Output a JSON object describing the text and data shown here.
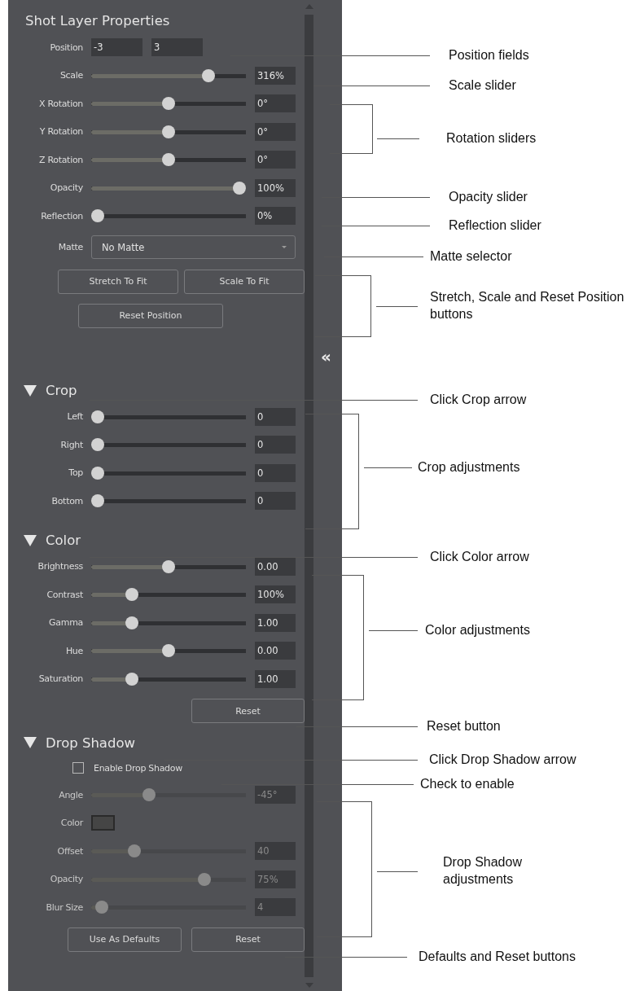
{
  "panel": {
    "title": "Shot Layer Properties",
    "collapse_glyph": "«",
    "rows": [
      {
        "kind": "position",
        "label": "Position",
        "values": [
          "-3",
          "3"
        ]
      },
      {
        "kind": "slider",
        "label": "Scale",
        "level": 0.78,
        "value": "316%",
        "disabled": false
      },
      {
        "kind": "slider",
        "label": "X Rotation",
        "level": 0.5,
        "value": "0°",
        "disabled": false
      },
      {
        "kind": "slider",
        "label": "Y Rotation",
        "level": 0.5,
        "value": "0°",
        "disabled": false
      },
      {
        "kind": "slider",
        "label": "Z Rotation",
        "level": 0.5,
        "value": "0°",
        "disabled": false
      },
      {
        "kind": "slider",
        "label": "Opacity",
        "level": 1,
        "value": "100%",
        "disabled": false
      },
      {
        "kind": "slider",
        "label": "Reflection",
        "level": 0,
        "value": "0%",
        "disabled": false
      },
      {
        "kind": "select",
        "label": "Matte",
        "value": "No Matte"
      },
      {
        "kind": "buttons",
        "buttons": [
          "Stretch To Fit",
          "Scale To Fit"
        ]
      },
      {
        "kind": "buttons",
        "buttons": [
          "Reset Position"
        ]
      }
    ],
    "sections": [
      {
        "title": "Crop",
        "expanded": true,
        "rows": [
          {
            "kind": "slider",
            "label": "Left",
            "level": 0,
            "value": "0",
            "disabled": false
          },
          {
            "kind": "slider",
            "label": "Right",
            "level": 0,
            "value": "0",
            "disabled": false
          },
          {
            "kind": "slider",
            "label": "Top",
            "level": 0,
            "value": "0",
            "disabled": false
          },
          {
            "kind": "slider",
            "label": "Bottom",
            "level": 0,
            "value": "0",
            "disabled": false
          }
        ]
      },
      {
        "title": "Color",
        "expanded": true,
        "rows": [
          {
            "kind": "slider",
            "label": "Brightness",
            "level": 0.5,
            "value": "0.00",
            "disabled": false
          },
          {
            "kind": "slider",
            "label": "Contrast",
            "level": 0.24,
            "value": "100%",
            "disabled": false
          },
          {
            "kind": "slider",
            "label": "Gamma",
            "level": 0.24,
            "value": "1.00",
            "disabled": false
          },
          {
            "kind": "slider",
            "label": "Hue",
            "level": 0.5,
            "value": "0.00",
            "disabled": false
          },
          {
            "kind": "slider",
            "label": "Saturation",
            "level": 0.24,
            "value": "1.00",
            "disabled": false
          },
          {
            "kind": "buttons",
            "buttons": [
              "Reset"
            ]
          }
        ]
      },
      {
        "title": "Drop Shadow",
        "expanded": true,
        "rows": [
          {
            "kind": "checkbox",
            "label": "Enable Drop Shadow",
            "checked": false
          },
          {
            "kind": "slider",
            "label": "Angle",
            "level": 0.36,
            "value": "-45°",
            "disabled": true
          },
          {
            "kind": "swatch",
            "label": "Color",
            "color": "#454545",
            "disabled": true
          },
          {
            "kind": "slider",
            "label": "Offset",
            "level": 0.26,
            "value": "40",
            "disabled": true
          },
          {
            "kind": "slider",
            "label": "Opacity",
            "level": 0.75,
            "value": "75%",
            "disabled": true
          },
          {
            "kind": "slider",
            "label": "Blur Size",
            "level": 0.03,
            "value": "4",
            "disabled": true
          },
          {
            "kind": "buttons",
            "buttons": [
              "Use As Defaults",
              "Reset"
            ]
          }
        ]
      }
    ]
  },
  "callouts": [
    {
      "kind": "line",
      "text": "Position fields"
    },
    {
      "kind": "line",
      "text": "Scale slider"
    },
    {
      "kind": "bracket",
      "text": "Rotation sliders"
    },
    {
      "kind": "line",
      "text": "Opacity slider"
    },
    {
      "kind": "line",
      "text": "Reflection slider"
    },
    {
      "kind": "line",
      "text": "Matte selector"
    },
    {
      "kind": "bracket",
      "text": "Stretch, Scale and Reset Position buttons"
    },
    {
      "kind": "line",
      "text": "Click Crop arrow"
    },
    {
      "kind": "bracket",
      "text": "Crop adjustments"
    },
    {
      "kind": "line",
      "text": "Click Color arrow"
    },
    {
      "kind": "bracket",
      "text": "Color adjustments"
    },
    {
      "kind": "line",
      "text": "Reset button"
    },
    {
      "kind": "line",
      "text": "Click Drop Shadow arrow"
    },
    {
      "kind": "line",
      "text": "Check to enable"
    },
    {
      "kind": "bracket",
      "text": "Drop Shadow adjustments"
    },
    {
      "kind": "line",
      "text": "Defaults and Reset buttons"
    }
  ]
}
